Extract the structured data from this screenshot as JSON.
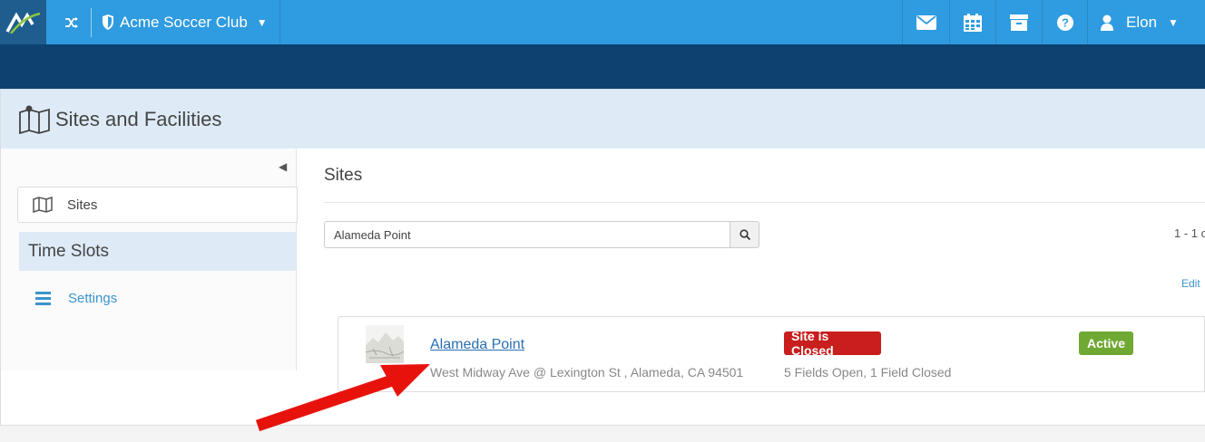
{
  "topbar": {
    "club_name": "Acme Soccer Club",
    "user_name": "Elon",
    "icons": [
      "logo-icon",
      "shuffle-icon",
      "shield-icon",
      "envelope-icon",
      "calendar-icon",
      "archive-icon",
      "help-icon",
      "user-icon",
      "chevron-down-icon"
    ],
    "colors": {
      "bar": "#2f9be0",
      "nav_band": "#0e416f",
      "logo_bg": "#1f5d8f"
    }
  },
  "page": {
    "title": "Sites and Facilities",
    "header_icon": "map-icon"
  },
  "sidebar": {
    "items": [
      {
        "label": "Sites",
        "icon": "map-icon"
      },
      {
        "label": "Time Slots"
      },
      {
        "label": "Settings",
        "icon": "menu-icon"
      }
    ]
  },
  "main": {
    "section_title": "Sites",
    "search": {
      "value": "Alameda Point",
      "placeholder": ""
    },
    "pager_text": "1 - 1 o",
    "edit_label": "Edit",
    "site": {
      "name": "Alameda Point",
      "address": "West Midway Ave @ Lexington St , Alameda, CA 94501",
      "status_badge": "Site is Closed",
      "fields_summary": "5 Fields Open, 1 Field Closed",
      "active_badge": "Active"
    },
    "colors": {
      "closed": "#c81e1e",
      "active": "#6fa833",
      "link": "#2a6fb0"
    }
  }
}
